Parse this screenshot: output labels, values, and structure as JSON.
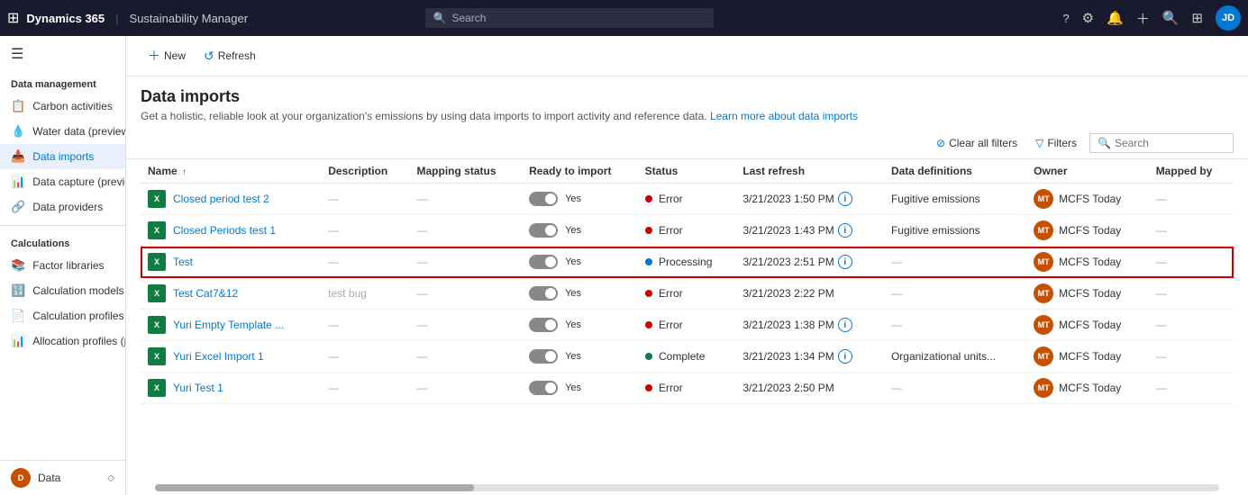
{
  "topnav": {
    "logo": "Dynamics 365",
    "sep": "|",
    "app": "Sustainability Manager",
    "search_placeholder": "Search",
    "avatar_initials": "JD"
  },
  "sidebar": {
    "hamburger": "☰",
    "sections": [
      {
        "title": "Data management",
        "items": [
          {
            "id": "carbon-activities",
            "label": "Carbon activities",
            "icon": "grid"
          },
          {
            "id": "water-data",
            "label": "Water data (preview)",
            "icon": "grid"
          },
          {
            "id": "data-imports",
            "label": "Data imports",
            "icon": "grid",
            "active": true
          },
          {
            "id": "data-capture",
            "label": "Data capture (preview)",
            "icon": "grid"
          },
          {
            "id": "data-providers",
            "label": "Data providers",
            "icon": "grid"
          }
        ]
      },
      {
        "title": "Calculations",
        "items": [
          {
            "id": "factor-libraries",
            "label": "Factor libraries",
            "icon": "grid"
          },
          {
            "id": "calculation-models",
            "label": "Calculation models",
            "icon": "grid"
          },
          {
            "id": "calculation-profiles",
            "label": "Calculation profiles",
            "icon": "grid"
          },
          {
            "id": "allocation-profiles",
            "label": "Allocation profiles (p...",
            "icon": "grid"
          }
        ]
      }
    ],
    "bottom": {
      "label": "Data",
      "avatar": "D",
      "chevron": "◇"
    }
  },
  "toolbar": {
    "new_label": "+ New",
    "refresh_label": "↺ Refresh"
  },
  "page": {
    "title": "Data imports",
    "description": "Get a holistic, reliable look at your organization's emissions by using data imports to import activity and reference data.",
    "learn_more": "Learn more about data imports"
  },
  "table_toolbar": {
    "clear_filters": "Clear all filters",
    "filters": "Filters",
    "search_placeholder": "Search"
  },
  "table": {
    "columns": [
      "Name ↑",
      "Description",
      "Mapping status",
      "Ready to import",
      "Status",
      "Last refresh",
      "Data definitions",
      "Owner",
      "Mapped by"
    ],
    "rows": [
      {
        "name": "Closed period test 2",
        "description": "—",
        "mapping_status": "—",
        "ready": "Yes",
        "status": "Error",
        "status_type": "error",
        "last_refresh": "3/21/2023 1:50 PM",
        "show_info": true,
        "data_definitions": "Fugitive emissions",
        "owner_initials": "MT",
        "owner_name": "MCFS Today",
        "mapped_by": "—",
        "highlighted": false
      },
      {
        "name": "Closed Periods test 1",
        "description": "—",
        "mapping_status": "—",
        "ready": "Yes",
        "status": "Error",
        "status_type": "error",
        "last_refresh": "3/21/2023 1:43 PM",
        "show_info": true,
        "data_definitions": "Fugitive emissions",
        "owner_initials": "MT",
        "owner_name": "MCFS Today",
        "mapped_by": "—",
        "highlighted": false
      },
      {
        "name": "Test",
        "description": "—",
        "mapping_status": "—",
        "ready": "Yes",
        "status": "Processing",
        "status_type": "processing",
        "last_refresh": "3/21/2023 2:51 PM",
        "show_info": true,
        "data_definitions": "—",
        "owner_initials": "MT",
        "owner_name": "MCFS Today",
        "mapped_by": "—",
        "highlighted": true
      },
      {
        "name": "Test Cat7&12",
        "description": "test bug",
        "mapping_status": "—",
        "ready": "Yes",
        "status": "Error",
        "status_type": "error",
        "last_refresh": "3/21/2023 2:22 PM",
        "show_info": false,
        "data_definitions": "—",
        "owner_initials": "MT",
        "owner_name": "MCFS Today",
        "mapped_by": "—",
        "highlighted": false
      },
      {
        "name": "Yuri Empty Template ...",
        "description": "—",
        "mapping_status": "—",
        "ready": "Yes",
        "status": "Error",
        "status_type": "error",
        "last_refresh": "3/21/2023 1:38 PM",
        "show_info": true,
        "data_definitions": "—",
        "owner_initials": "MT",
        "owner_name": "MCFS Today",
        "mapped_by": "—",
        "highlighted": false
      },
      {
        "name": "Yuri Excel Import 1",
        "description": "—",
        "mapping_status": "—",
        "ready": "Yes",
        "status": "Complete",
        "status_type": "complete",
        "last_refresh": "3/21/2023 1:34 PM",
        "show_info": true,
        "data_definitions": "Organizational units...",
        "owner_initials": "MT",
        "owner_name": "MCFS Today",
        "mapped_by": "—",
        "highlighted": false
      },
      {
        "name": "Yuri Test 1",
        "description": "—",
        "mapping_status": "—",
        "ready": "Yes",
        "status": "Error",
        "status_type": "error",
        "last_refresh": "3/21/2023 2:50 PM",
        "show_info": false,
        "data_definitions": "—",
        "owner_initials": "MT",
        "owner_name": "MCFS Today",
        "mapped_by": "—",
        "highlighted": false
      }
    ]
  }
}
